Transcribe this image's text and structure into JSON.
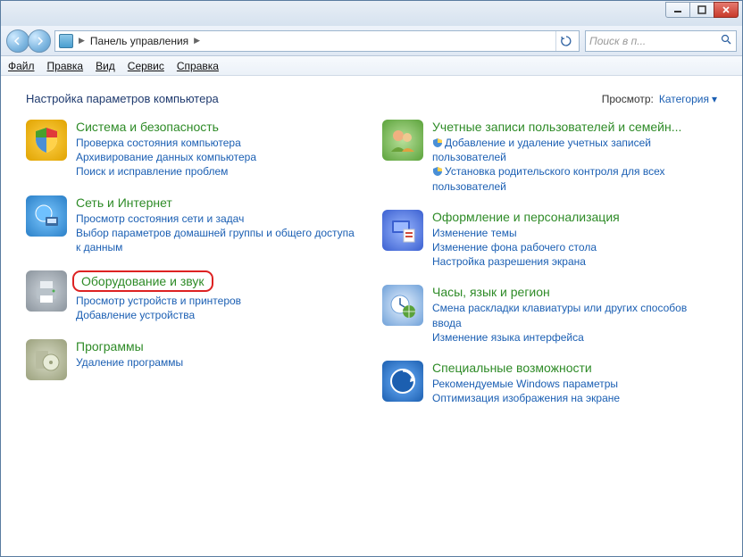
{
  "window": {
    "breadcrumb": "Панель управления",
    "search_placeholder": "Поиск в п..."
  },
  "menu": {
    "file": "Файл",
    "edit": "Правка",
    "view": "Вид",
    "tools": "Сервис",
    "help": "Справка"
  },
  "heading": "Настройка параметров компьютера",
  "view_label": "Просмотр:",
  "view_value": "Категория",
  "left": [
    {
      "title": "Система и безопасность",
      "links": [
        "Проверка состояния компьютера",
        "Архивирование данных компьютера",
        "Поиск и исправление проблем"
      ]
    },
    {
      "title": "Сеть и Интернет",
      "links": [
        "Просмотр состояния сети и задач",
        "Выбор параметров домашней группы и общего доступа к данным"
      ]
    },
    {
      "title": "Оборудование и звук",
      "highlighted": true,
      "links": [
        "Просмотр устройств и принтеров",
        "Добавление устройства"
      ]
    },
    {
      "title": "Программы",
      "links": [
        "Удаление программы"
      ]
    }
  ],
  "right": [
    {
      "title": "Учетные записи пользователей и семейн...",
      "links": [
        {
          "shield": true,
          "text": "Добавление и удаление учетных записей пользователей"
        },
        {
          "shield": true,
          "text": "Установка родительского контроля для всех пользователей"
        }
      ]
    },
    {
      "title": "Оформление и персонализация",
      "links": [
        "Изменение темы",
        "Изменение фона рабочего стола",
        "Настройка разрешения экрана"
      ]
    },
    {
      "title": "Часы, язык и регион",
      "links": [
        "Смена раскладки клавиатуры или других способов ввода",
        "Изменение языка интерфейса"
      ]
    },
    {
      "title": "Специальные возможности",
      "links": [
        "Рекомендуемые Windows параметры",
        "Оптимизация изображения на экране"
      ]
    }
  ]
}
